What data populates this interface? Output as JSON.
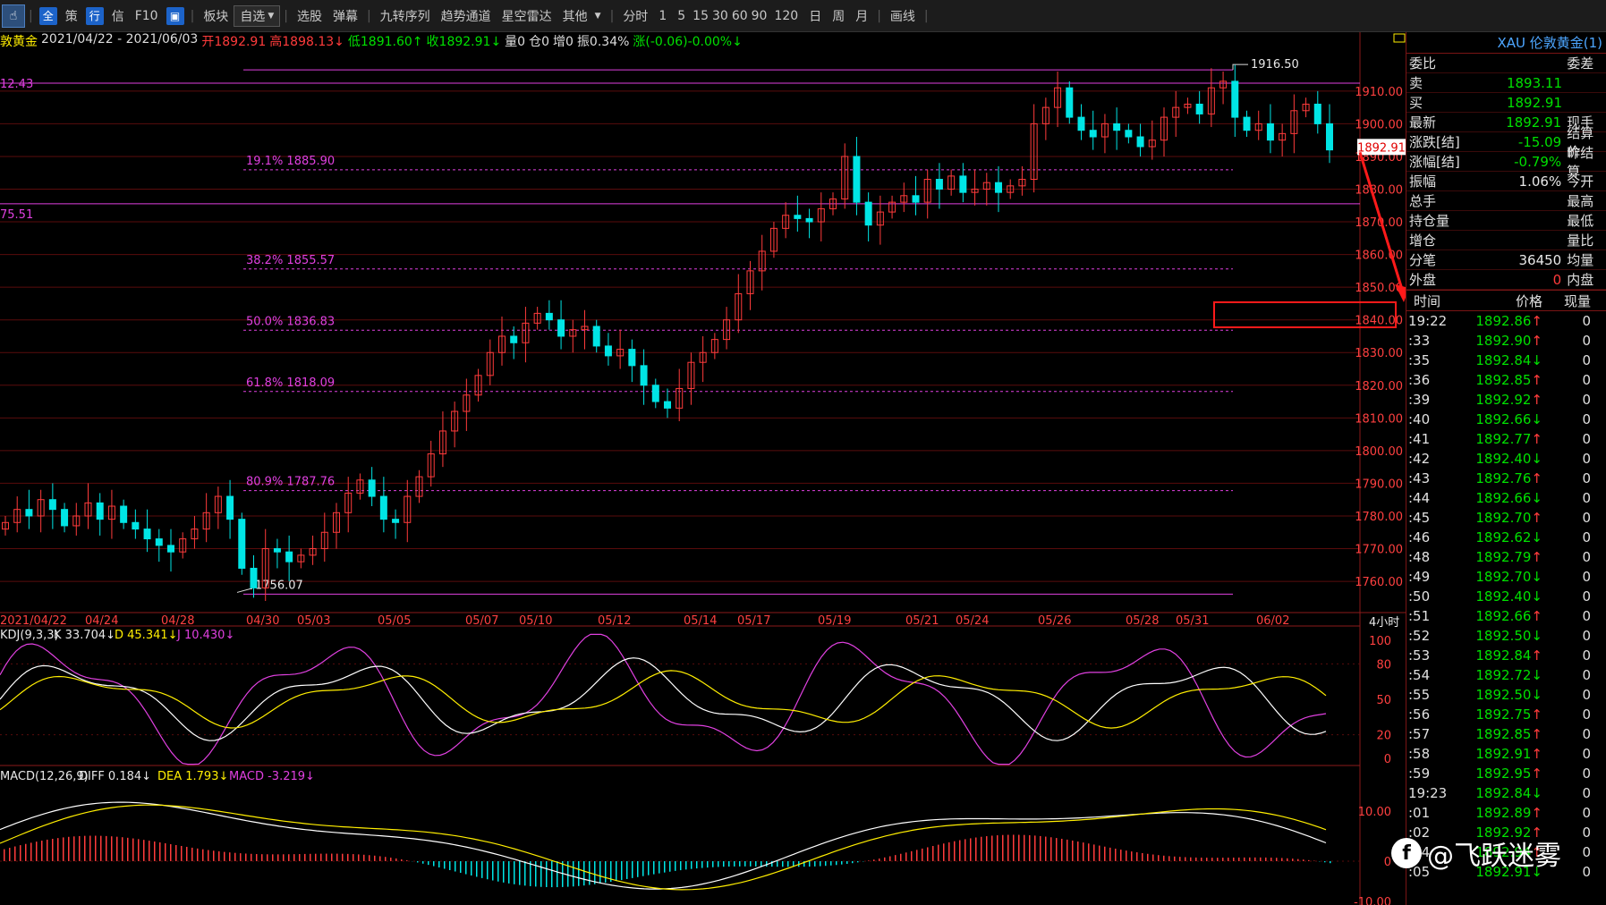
{
  "toolbar": {
    "items": [
      "全",
      "策",
      "行",
      "信",
      "F10",
      "板块",
      "自选",
      "选股",
      "弹幕",
      "九转序列",
      "趋势通道",
      "星空雷达",
      "其他",
      "分时",
      "1",
      "5",
      "15",
      "30",
      "60",
      "90",
      "120",
      "日",
      "周",
      "月",
      "画线"
    ]
  },
  "info": {
    "name": "敦黄金",
    "range": "2021/04/22 - 2021/06/03",
    "open": "开1892.91",
    "high": "高1898.13",
    "high_arrow": "↓",
    "low": "低1891.60",
    "low_arrow": "↑",
    "close": "收1892.91",
    "close_arrow": "↓",
    "vol": "量0",
    "oi": "仓0",
    "inc": "增0",
    "amp": "振0.34%",
    "chg": "涨(-0.06)-0.00%",
    "chg_arrow": "↓"
  },
  "chart_data": [
    {
      "type": "candlestick",
      "title": "",
      "price_axis": [
        1910,
        1900,
        1890,
        1880,
        1870,
        1860,
        1850,
        1840,
        1830,
        1820,
        1810,
        1800,
        1790,
        1780,
        1770,
        1760
      ],
      "price_axis_labels": [
        "1910.00",
        "1900.00",
        "1890.00",
        "1880.00",
        "1870.00",
        "1860.00",
        "1850.00",
        "1840.00",
        "1830.00",
        "1820.00",
        "1810.00",
        "1800.00",
        "1790.00",
        "1780.00",
        "1770.00",
        "1760.00"
      ],
      "ylim": [
        1754,
        1922
      ],
      "x_labels": [
        "2021/04/22",
        "04/24",
        "04/28",
        "04/30",
        "05/03",
        "05/05",
        "05/07",
        "05/10",
        "05/12",
        "05/14",
        "05/17",
        "05/19",
        "05/21",
        "05/24",
        "05/26",
        "05/28",
        "05/31",
        "06/02"
      ],
      "period_label": "4小时",
      "current_price": "1892.91",
      "left_labels": [
        "12.43",
        "75.51"
      ],
      "high_marker": "1916.50",
      "low_marker": "1756.07",
      "fib_levels": [
        {
          "label": "19.1% 1885.90",
          "value": 1885.9
        },
        {
          "label": "38.2% 1855.57",
          "value": 1855.57
        },
        {
          "label": "50.0% 1836.83",
          "value": 1836.83
        },
        {
          "label": "61.8% 1818.09",
          "value": 1818.09
        },
        {
          "label": "80.9% 1787.76",
          "value": 1787.76
        }
      ],
      "close_path": [
        1778,
        1782,
        1780,
        1785,
        1782,
        1777,
        1780,
        1784,
        1779,
        1783,
        1778,
        1776,
        1773,
        1771,
        1769,
        1773,
        1776,
        1781,
        1786,
        1779,
        1764,
        1758,
        1770,
        1769,
        1766,
        1768,
        1770,
        1775,
        1781,
        1787,
        1791,
        1786,
        1779,
        1778,
        1786,
        1792,
        1799,
        1806,
        1812,
        1817,
        1823,
        1830,
        1835,
        1833,
        1839,
        1842,
        1840,
        1835,
        1837,
        1838,
        1832,
        1829,
        1831,
        1826,
        1820,
        1815,
        1813,
        1819,
        1827,
        1830,
        1834,
        1840,
        1848,
        1855,
        1861,
        1868,
        1872,
        1871,
        1870,
        1874,
        1877,
        1890,
        1876,
        1869,
        1873,
        1876,
        1878,
        1876,
        1883,
        1880,
        1884,
        1879,
        1880,
        1882,
        1879,
        1881,
        1883,
        1900,
        1905,
        1911,
        1902,
        1898,
        1896,
        1900,
        1898,
        1896,
        1893,
        1895,
        1902,
        1905,
        1906,
        1903,
        1911,
        1913,
        1902,
        1898,
        1900,
        1895,
        1897,
        1904,
        1906,
        1900,
        1892
      ]
    },
    {
      "type": "line",
      "title": "KDJ",
      "header": "KDJ(9,3,3)",
      "series": [
        {
          "name": "K",
          "label": "K 33.704",
          "arrow": "↓",
          "color": "#ffffff"
        },
        {
          "name": "D",
          "label": "D 45.341",
          "arrow": "↓",
          "color": "#ffee00"
        },
        {
          "name": "J",
          "label": "J 10.430",
          "arrow": "↓",
          "color": "#e040e0"
        }
      ],
      "y_axis": [
        "100",
        "80",
        "50",
        "20",
        "0"
      ]
    },
    {
      "type": "line",
      "title": "MACD",
      "header": "MACD(12,26,9)",
      "series": [
        {
          "name": "DIFF",
          "label": "DIFF 0.184",
          "arrow": "↓",
          "color": "#ffffff"
        },
        {
          "name": "DEA",
          "label": "DEA 1.793",
          "arrow": "↓",
          "color": "#ffee00"
        },
        {
          "name": "MACD",
          "label": "MACD -3.219",
          "arrow": "↓",
          "color": "#e040e0"
        }
      ],
      "y_axis": [
        "10.00",
        "0",
        "-10.00"
      ]
    }
  ],
  "quote_panel": {
    "title": "XAU 伦敦黄金(1)",
    "row0": {
      "k": "委比",
      "k2": "委差"
    },
    "sell": {
      "k": "卖",
      "v": "1893.11"
    },
    "buy": {
      "k": "买",
      "v": "1892.91"
    },
    "rows": [
      {
        "k": "最新",
        "v": "1892.91",
        "k2": "现手",
        "cls": "dn"
      },
      {
        "k": "涨跌[结]",
        "v": "-15.09",
        "k2": "结算价",
        "cls": "dn"
      },
      {
        "k": "涨幅[结]",
        "v": "-0.79%",
        "k2": "昨结算",
        "cls": "dn"
      },
      {
        "k": "振幅",
        "v": "1.06%",
        "k2": "今开",
        "cls": "wht"
      },
      {
        "k": "总手",
        "v": "",
        "k2": "最高",
        "cls": "wht"
      },
      {
        "k": "持仓量",
        "v": "",
        "k2": "最低",
        "cls": "wht"
      },
      {
        "k": "增仓",
        "v": "",
        "k2": "量比",
        "cls": "wht"
      },
      {
        "k": "分笔",
        "v": "36450",
        "k2": "均量",
        "cls": "wht"
      },
      {
        "k": "外盘",
        "v": "0",
        "k2": "内盘",
        "cls": "up"
      }
    ],
    "ticks_header": {
      "t": "时间",
      "p": "价格",
      "q": "现量"
    },
    "ticks": [
      {
        "t": "19:22",
        "p": "1892.86",
        "a": "↑",
        "q": "0"
      },
      {
        "t": ":33",
        "p": "1892.90",
        "a": "↑",
        "q": "0"
      },
      {
        "t": ":35",
        "p": "1892.84",
        "a": "↓",
        "q": "0"
      },
      {
        "t": ":36",
        "p": "1892.85",
        "a": "↑",
        "q": "0"
      },
      {
        "t": ":39",
        "p": "1892.92",
        "a": "↑",
        "q": "0"
      },
      {
        "t": ":40",
        "p": "1892.66",
        "a": "↓",
        "q": "0"
      },
      {
        "t": ":41",
        "p": "1892.77",
        "a": "↑",
        "q": "0"
      },
      {
        "t": ":42",
        "p": "1892.40",
        "a": "↓",
        "q": "0"
      },
      {
        "t": ":43",
        "p": "1892.76",
        "a": "↑",
        "q": "0"
      },
      {
        "t": ":44",
        "p": "1892.66",
        "a": "↓",
        "q": "0"
      },
      {
        "t": ":45",
        "p": "1892.70",
        "a": "↑",
        "q": "0"
      },
      {
        "t": ":46",
        "p": "1892.62",
        "a": "↓",
        "q": "0"
      },
      {
        "t": ":48",
        "p": "1892.79",
        "a": "↑",
        "q": "0"
      },
      {
        "t": ":49",
        "p": "1892.70",
        "a": "↓",
        "q": "0"
      },
      {
        "t": ":50",
        "p": "1892.40",
        "a": "↓",
        "q": "0"
      },
      {
        "t": ":51",
        "p": "1892.66",
        "a": "↑",
        "q": "0"
      },
      {
        "t": ":52",
        "p": "1892.50",
        "a": "↓",
        "q": "0"
      },
      {
        "t": ":53",
        "p": "1892.84",
        "a": "↑",
        "q": "0"
      },
      {
        "t": ":54",
        "p": "1892.72",
        "a": "↓",
        "q": "0"
      },
      {
        "t": ":55",
        "p": "1892.50",
        "a": "↓",
        "q": "0"
      },
      {
        "t": ":56",
        "p": "1892.75",
        "a": "↑",
        "q": "0"
      },
      {
        "t": ":57",
        "p": "1892.85",
        "a": "↑",
        "q": "0"
      },
      {
        "t": ":58",
        "p": "1892.91",
        "a": "↑",
        "q": "0"
      },
      {
        "t": ":59",
        "p": "1892.95",
        "a": "↑",
        "q": "0"
      },
      {
        "t": "19:23",
        "p": "1892.84",
        "a": "↓",
        "q": "0"
      },
      {
        "t": ":01",
        "p": "1892.89",
        "a": "↑",
        "q": "0"
      },
      {
        "t": ":02",
        "p": "1892.92",
        "a": "↑",
        "q": "0"
      },
      {
        "t": ":04",
        "p": "1892.94",
        "a": "↑",
        "q": "0"
      },
      {
        "t": ":05",
        "p": "1892.91",
        "a": "↓",
        "q": "0"
      }
    ]
  },
  "watermark": {
    "logo": "f",
    "text": "@飞跃迷雾"
  },
  "colors": {
    "up": "#ff3b3b",
    "down": "#00e5e5",
    "fib": "#e040e0",
    "grid": "#5a0c0c",
    "axis_text": "#ff4040"
  }
}
